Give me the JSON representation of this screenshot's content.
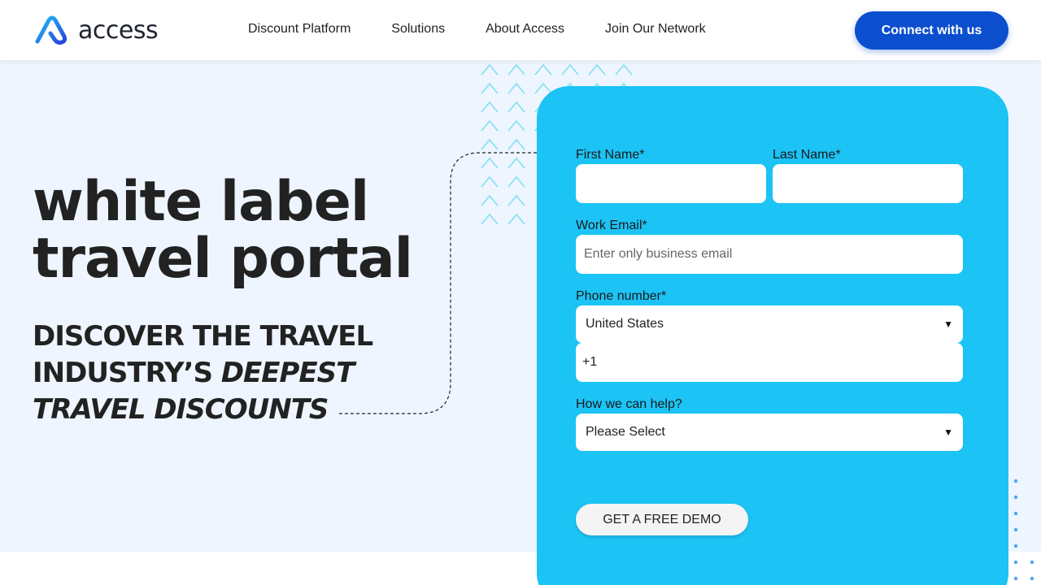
{
  "brand": {
    "name": "access"
  },
  "nav": {
    "items": [
      "Discount Platform",
      "Solutions",
      "About Access",
      "Join Our Network"
    ],
    "cta_label": "Connect with us"
  },
  "hero": {
    "title_line1": "white label",
    "title_line2": "travel portal",
    "subtitle_part1": "DISCOVER THE TRAVEL INDUSTRY’S ",
    "subtitle_emphasis": "DEEPEST TRAVEL DISCOUNTS"
  },
  "form": {
    "first_name_label": "First Name*",
    "last_name_label": "Last Name*",
    "email_label": "Work Email*",
    "email_placeholder": "Enter only business email",
    "phone_label": "Phone number*",
    "country_value": "United States",
    "phone_value": "+1",
    "help_label": "How we can help?",
    "help_value": "Please Select",
    "submit_label": "GET A FREE DEMO"
  },
  "colors": {
    "accent": "#0b4fcf",
    "card": "#1cc3f5",
    "hero_bg": "#eef5fe"
  }
}
